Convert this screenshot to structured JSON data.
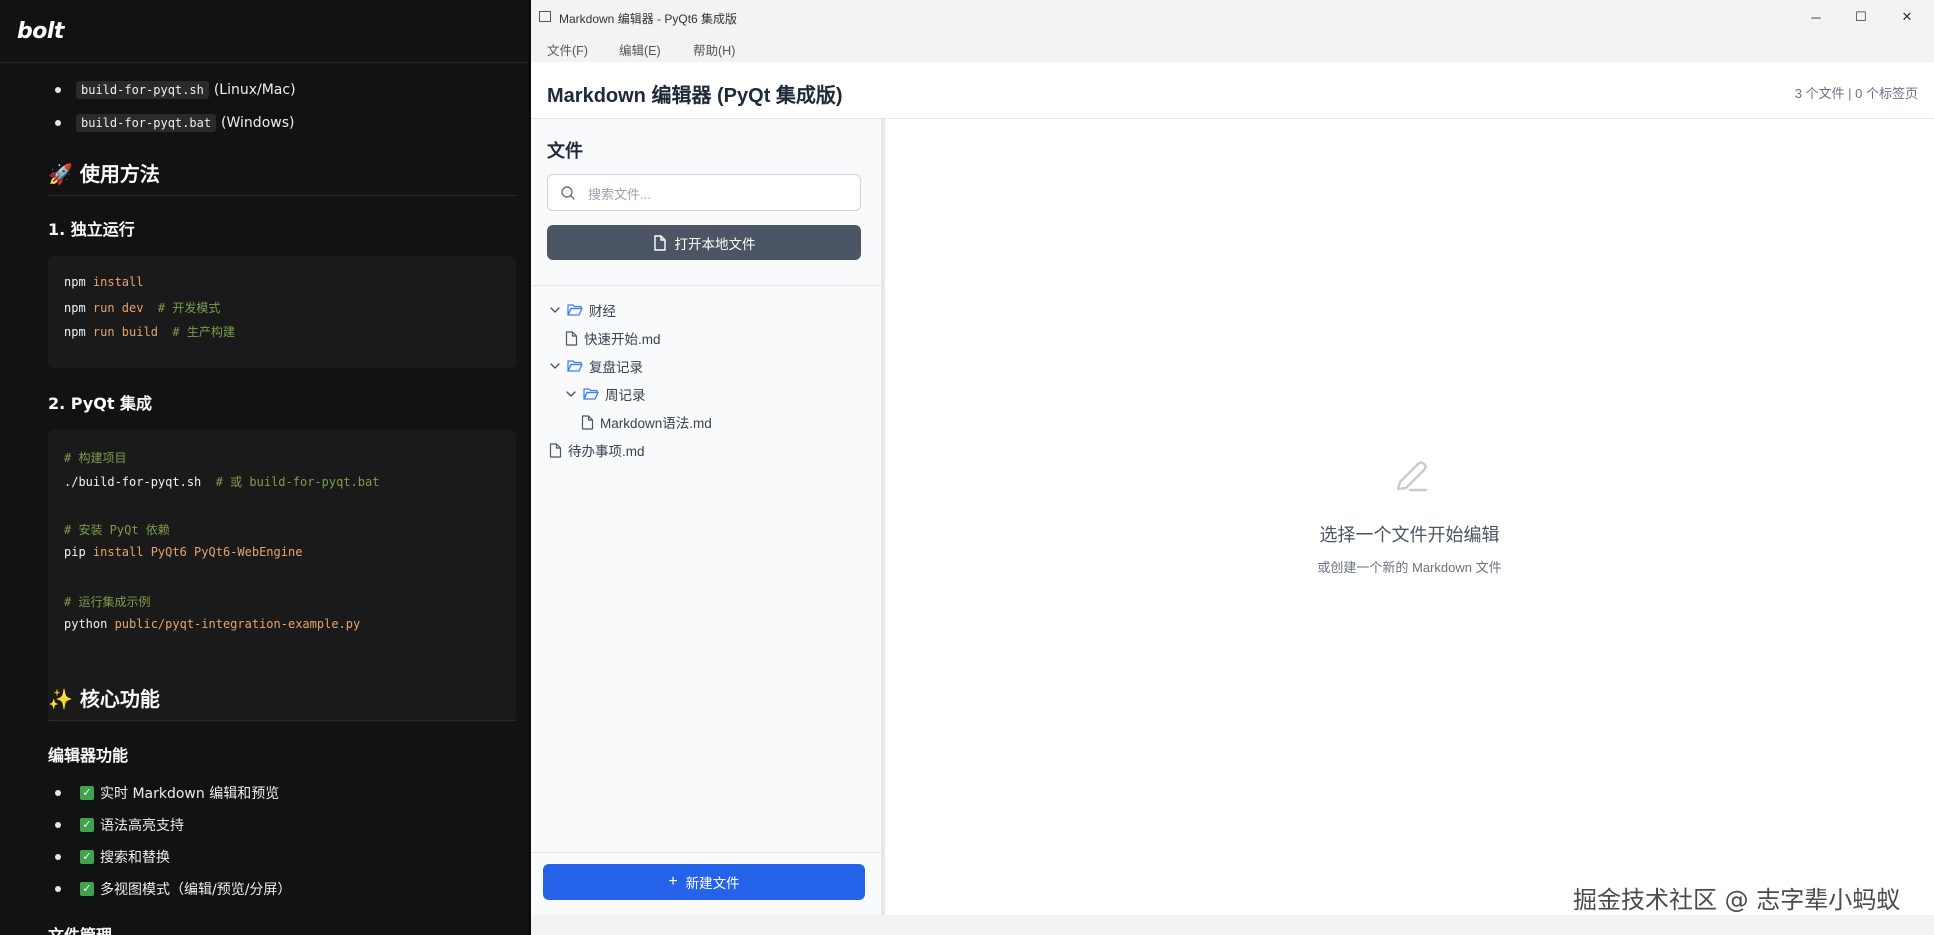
{
  "left_pane": {
    "brand": "bolt",
    "bullets_build": [
      {
        "code": "build-for-pyqt.sh",
        "text": "(Linux/Mac)"
      },
      {
        "code": "build-for-pyqt.bat",
        "text": "(Windows)"
      }
    ],
    "usage_heading": "🚀 使用方法",
    "standalone_heading": "1. 独立运行",
    "standalone_code": [
      [
        {
          "t": "npm ",
          "c": "w"
        },
        {
          "t": "install",
          "c": "o"
        }
      ],
      [
        {
          "t": "npm ",
          "c": "w"
        },
        {
          "t": "run dev",
          "c": "o"
        },
        {
          "t": "  # 开发模式",
          "c": "g"
        }
      ],
      [
        {
          "t": "npm ",
          "c": "w"
        },
        {
          "t": "run build",
          "c": "o"
        },
        {
          "t": "  # 生产构建",
          "c": "g"
        }
      ]
    ],
    "pyqt_heading": "2. PyQt 集成",
    "pyqt_code": [
      [
        {
          "t": "# 构建项目",
          "c": "g"
        }
      ],
      [
        {
          "t": "./build-for-pyqt.sh",
          "c": "w"
        },
        {
          "t": "  # 或 build-for-pyqt.bat",
          "c": "g"
        }
      ],
      [],
      [
        {
          "t": "# 安装 PyQt 依赖",
          "c": "g"
        }
      ],
      [
        {
          "t": "pip ",
          "c": "w"
        },
        {
          "t": "install PyQt6 PyQt6-WebEngine",
          "c": "o"
        }
      ],
      [],
      [
        {
          "t": "# 运行集成示例",
          "c": "g"
        }
      ],
      [
        {
          "t": "python ",
          "c": "w"
        },
        {
          "t": "public/pyqt-integration-example.py",
          "c": "o"
        }
      ]
    ],
    "features_heading": "✨ 核心功能",
    "editor_features_heading": "编辑器功能",
    "editor_features": [
      "实时 Markdown 编辑和预览",
      "语法高亮支持",
      "搜索和替换",
      "多视图模式（编辑/预览/分屏）"
    ],
    "next_heading_partial": "文件管理"
  },
  "window": {
    "title": "Markdown 编辑器 - PyQt6 集成版",
    "controls": {
      "minimize": "─",
      "maximize": "☐",
      "close": "✕"
    },
    "menu": [
      "文件(F)",
      "编辑(E)",
      "帮助(H)"
    ],
    "app_title": "Markdown 编辑器 (PyQt 集成版)",
    "stats": "3 个文件 | 0 个标签页",
    "sidebar": {
      "heading": "文件",
      "search_placeholder": "搜索文件...",
      "open_local_label": "打开本地文件",
      "new_file_label": "新建文件",
      "tree": [
        {
          "type": "folder",
          "name": "财经",
          "depth": 0,
          "expanded": true
        },
        {
          "type": "file",
          "name": "快速开始.md",
          "depth": 1
        },
        {
          "type": "folder",
          "name": "复盘记录",
          "depth": 0,
          "expanded": true
        },
        {
          "type": "folder",
          "name": "周记录",
          "depth": 1,
          "expanded": true
        },
        {
          "type": "file",
          "name": "Markdown语法.md",
          "depth": 2
        },
        {
          "type": "file",
          "name": "待办事项.md",
          "depth": 0
        }
      ]
    },
    "empty_state": {
      "title": "选择一个文件开始编辑",
      "subtitle": "或创建一个新的 Markdown 文件"
    },
    "watermark": "掘金技术社区 @ 志字辈小蚂蚁"
  }
}
